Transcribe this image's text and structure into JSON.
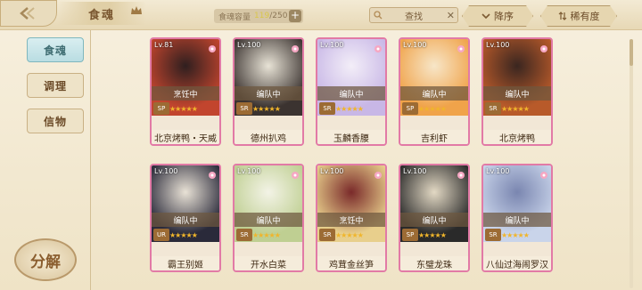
{
  "header": {
    "title": "食魂",
    "capacity_label": "食魂容量",
    "capacity_current": "119",
    "capacity_total": "/250",
    "add_symbol": "+",
    "search_label": "查找",
    "clear_symbol": "✕",
    "sort_order_label": "降序",
    "sort_rarity_label": "稀有度"
  },
  "sidebar": {
    "tabs": [
      {
        "label": "食魂",
        "active": true
      },
      {
        "label": "调理",
        "active": false
      },
      {
        "label": "信物",
        "active": false
      }
    ],
    "decompose_label": "分解"
  },
  "cards": [
    {
      "level": "Lv.81",
      "status": "烹饪中",
      "badge": "SP",
      "name": "北京烤鸭・天威",
      "colors": [
        "#c2452e",
        "#2f1f1f"
      ]
    },
    {
      "level": "Lv.100",
      "status": "编队中",
      "badge": "SR",
      "name": "德州扒鸡",
      "colors": [
        "#3b3330",
        "#e8e3d6"
      ]
    },
    {
      "level": "Lv.100",
      "status": "编队中",
      "badge": "SR",
      "name": "玉麟香腰",
      "colors": [
        "#c8b7e6",
        "#f3eef8"
      ]
    },
    {
      "level": "Lv.100",
      "status": "编队中",
      "badge": "SP",
      "name": "吉利虾",
      "colors": [
        "#f0a34a",
        "#f7e6c8"
      ]
    },
    {
      "level": "Lv.100",
      "status": "编队中",
      "badge": "SR",
      "name": "北京烤鸭",
      "colors": [
        "#b85a2a",
        "#3a2620"
      ]
    },
    {
      "level": "Lv.100",
      "status": "编队中",
      "badge": "UR",
      "name": "霸王别姬",
      "colors": [
        "#2a2a3a",
        "#e9e2d6"
      ]
    },
    {
      "level": "Lv.100",
      "status": "编队中",
      "badge": "SR",
      "name": "开水白菜",
      "colors": [
        "#bfcf92",
        "#f3f3e6"
      ]
    },
    {
      "level": "Lv.100",
      "status": "烹饪中",
      "badge": "SR",
      "name": "鸡茸金丝笋",
      "colors": [
        "#e8cf8c",
        "#7a2a2a"
      ]
    },
    {
      "level": "Lv.100",
      "status": "编队中",
      "badge": "SP",
      "name": "东璧龙珠",
      "colors": [
        "#2a2a2a",
        "#e3d9c4"
      ]
    },
    {
      "level": "Lv.100",
      "status": "编队中",
      "badge": "SR",
      "name": "八仙过海闹罗汉",
      "colors": [
        "#c9d4ea",
        "#7a86b0"
      ]
    }
  ],
  "stars_display": "★★★★★",
  "colors": {
    "accent": "#e27aa6",
    "panel_bg": "#f4ecd8",
    "active_tab": "#b9dde2"
  }
}
